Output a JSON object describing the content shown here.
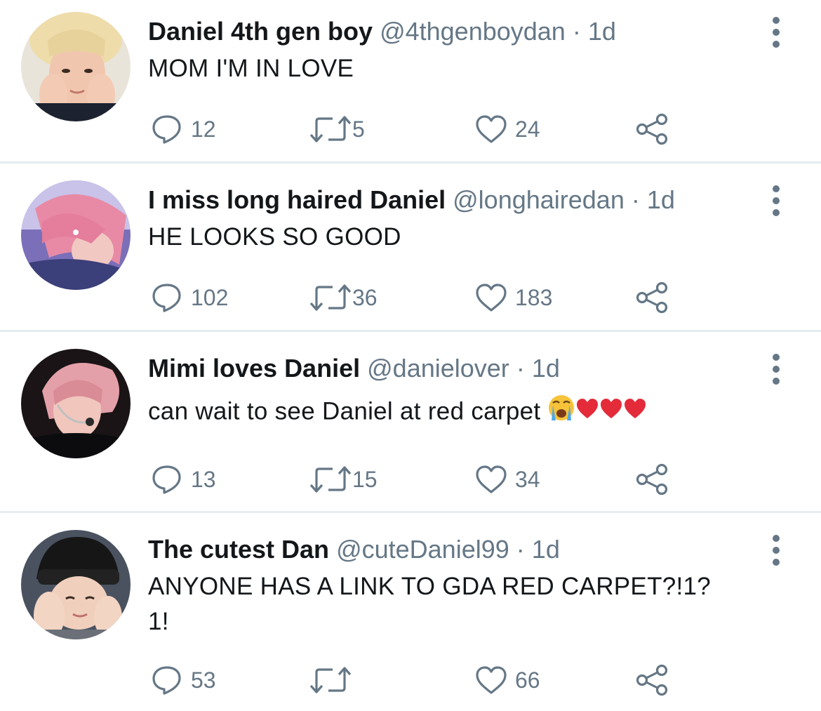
{
  "colors": {
    "text": "#14171a",
    "secondary": "#657786",
    "divider": "#e6ecf0",
    "heart": "#e0245e"
  },
  "tweets": [
    {
      "name": "Daniel 4th gen boy",
      "handle": "@4thgenboydan",
      "dot": "·",
      "time": "1d",
      "text": "MOM I'M IN LOVE",
      "text2": "",
      "replies": "12",
      "retweets": "5",
      "likes": "24",
      "avatar": "blond-hair-avatar"
    },
    {
      "name": "I miss long haired Daniel",
      "handle": "@longhairedan",
      "dot": "·",
      "time": "1d",
      "text": "HE LOOKS SO GOOD",
      "text2": "",
      "replies": "102",
      "retweets": "36",
      "likes": "183",
      "avatar": "pink-long-hair-avatar"
    },
    {
      "name": "Mimi loves Daniel",
      "handle": "@danielover",
      "dot": "·",
      "time": "1d",
      "text": "can wait to see Daniel at red carpet",
      "text2": "",
      "replies": "13",
      "retweets": "15",
      "likes": "34",
      "avatar": "pink-hair-headset-avatar",
      "emojis": [
        "crying-face-emoji",
        "red-heart-emoji",
        "red-heart-emoji",
        "red-heart-emoji"
      ]
    },
    {
      "name": "The cutest Dan",
      "handle": "@cuteDaniel99",
      "dot": "·",
      "time": "1d",
      "text": "ANYONE HAS A LINK TO GDA RED CARPET?!1?",
      "text2": "1!",
      "replies": "53",
      "retweets": "",
      "likes": "66",
      "avatar": "black-beanie-avatar"
    }
  ]
}
